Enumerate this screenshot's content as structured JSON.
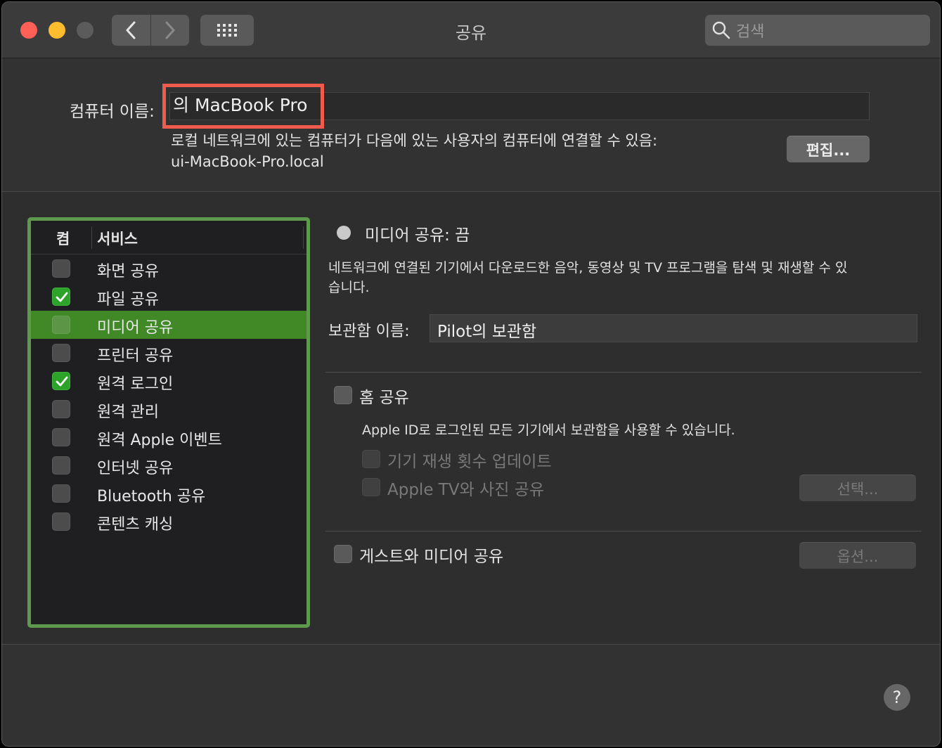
{
  "window": {
    "title": "공유"
  },
  "toolbar": {
    "search_placeholder": "검색",
    "back_icon": "chevron-left-icon",
    "forward_icon": "chevron-right-icon",
    "grid_icon": "grid-icon"
  },
  "computer_name": {
    "label": "컴퓨터 이름:",
    "value": "의 MacBook Pro",
    "local_desc_line1": "로컬 네트워크에 있는 컴퓨터가 다음에 있는 사용자의 컴퓨터에 연결할 수 있음:",
    "local_desc_line2": "ui-MacBook-Pro.local",
    "edit_button": "편집..."
  },
  "services": {
    "header_on": "켬",
    "header_service": "서비스",
    "items": [
      {
        "label": "화면 공유",
        "checked": false
      },
      {
        "label": "파일 공유",
        "checked": true
      },
      {
        "label": "미디어 공유",
        "checked": false,
        "selected": true
      },
      {
        "label": "프린터 공유",
        "checked": false
      },
      {
        "label": "원격 로그인",
        "checked": true
      },
      {
        "label": "원격 관리",
        "checked": false
      },
      {
        "label": "원격 Apple 이벤트",
        "checked": false
      },
      {
        "label": "인터넷 공유",
        "checked": false
      },
      {
        "label": "Bluetooth 공유",
        "checked": false
      },
      {
        "label": "콘텐츠 캐싱",
        "checked": false
      }
    ]
  },
  "detail": {
    "status": "미디어 공유: 끔",
    "description_line1": "네트워크에 연결된 기기에서 다운로드한 음악, 동영상 및 TV 프로그램을 탐색 및 재생할 수 있",
    "description_line2": "습니다.",
    "library_label": "보관함 이름:",
    "library_value": "Pilot의 보관함",
    "home_sharing": "홈 공유",
    "home_desc": "Apple ID로 로그인된 모든 기기에서 보관함을 사용할 수 있습니다.",
    "update_play_counts": "기기 재생 횟수 업데이트",
    "appletv_photos": "Apple TV와 사진 공유",
    "select_button": "선택...",
    "guest_sharing": "게스트와 미디어 공유",
    "options_button": "옵션..."
  },
  "colors": {
    "highlight_red": "#ef5b4c",
    "panel_green": "#5d9a4e",
    "selected_row": "#418827",
    "check_green": "#2ea32c"
  },
  "help": "?"
}
